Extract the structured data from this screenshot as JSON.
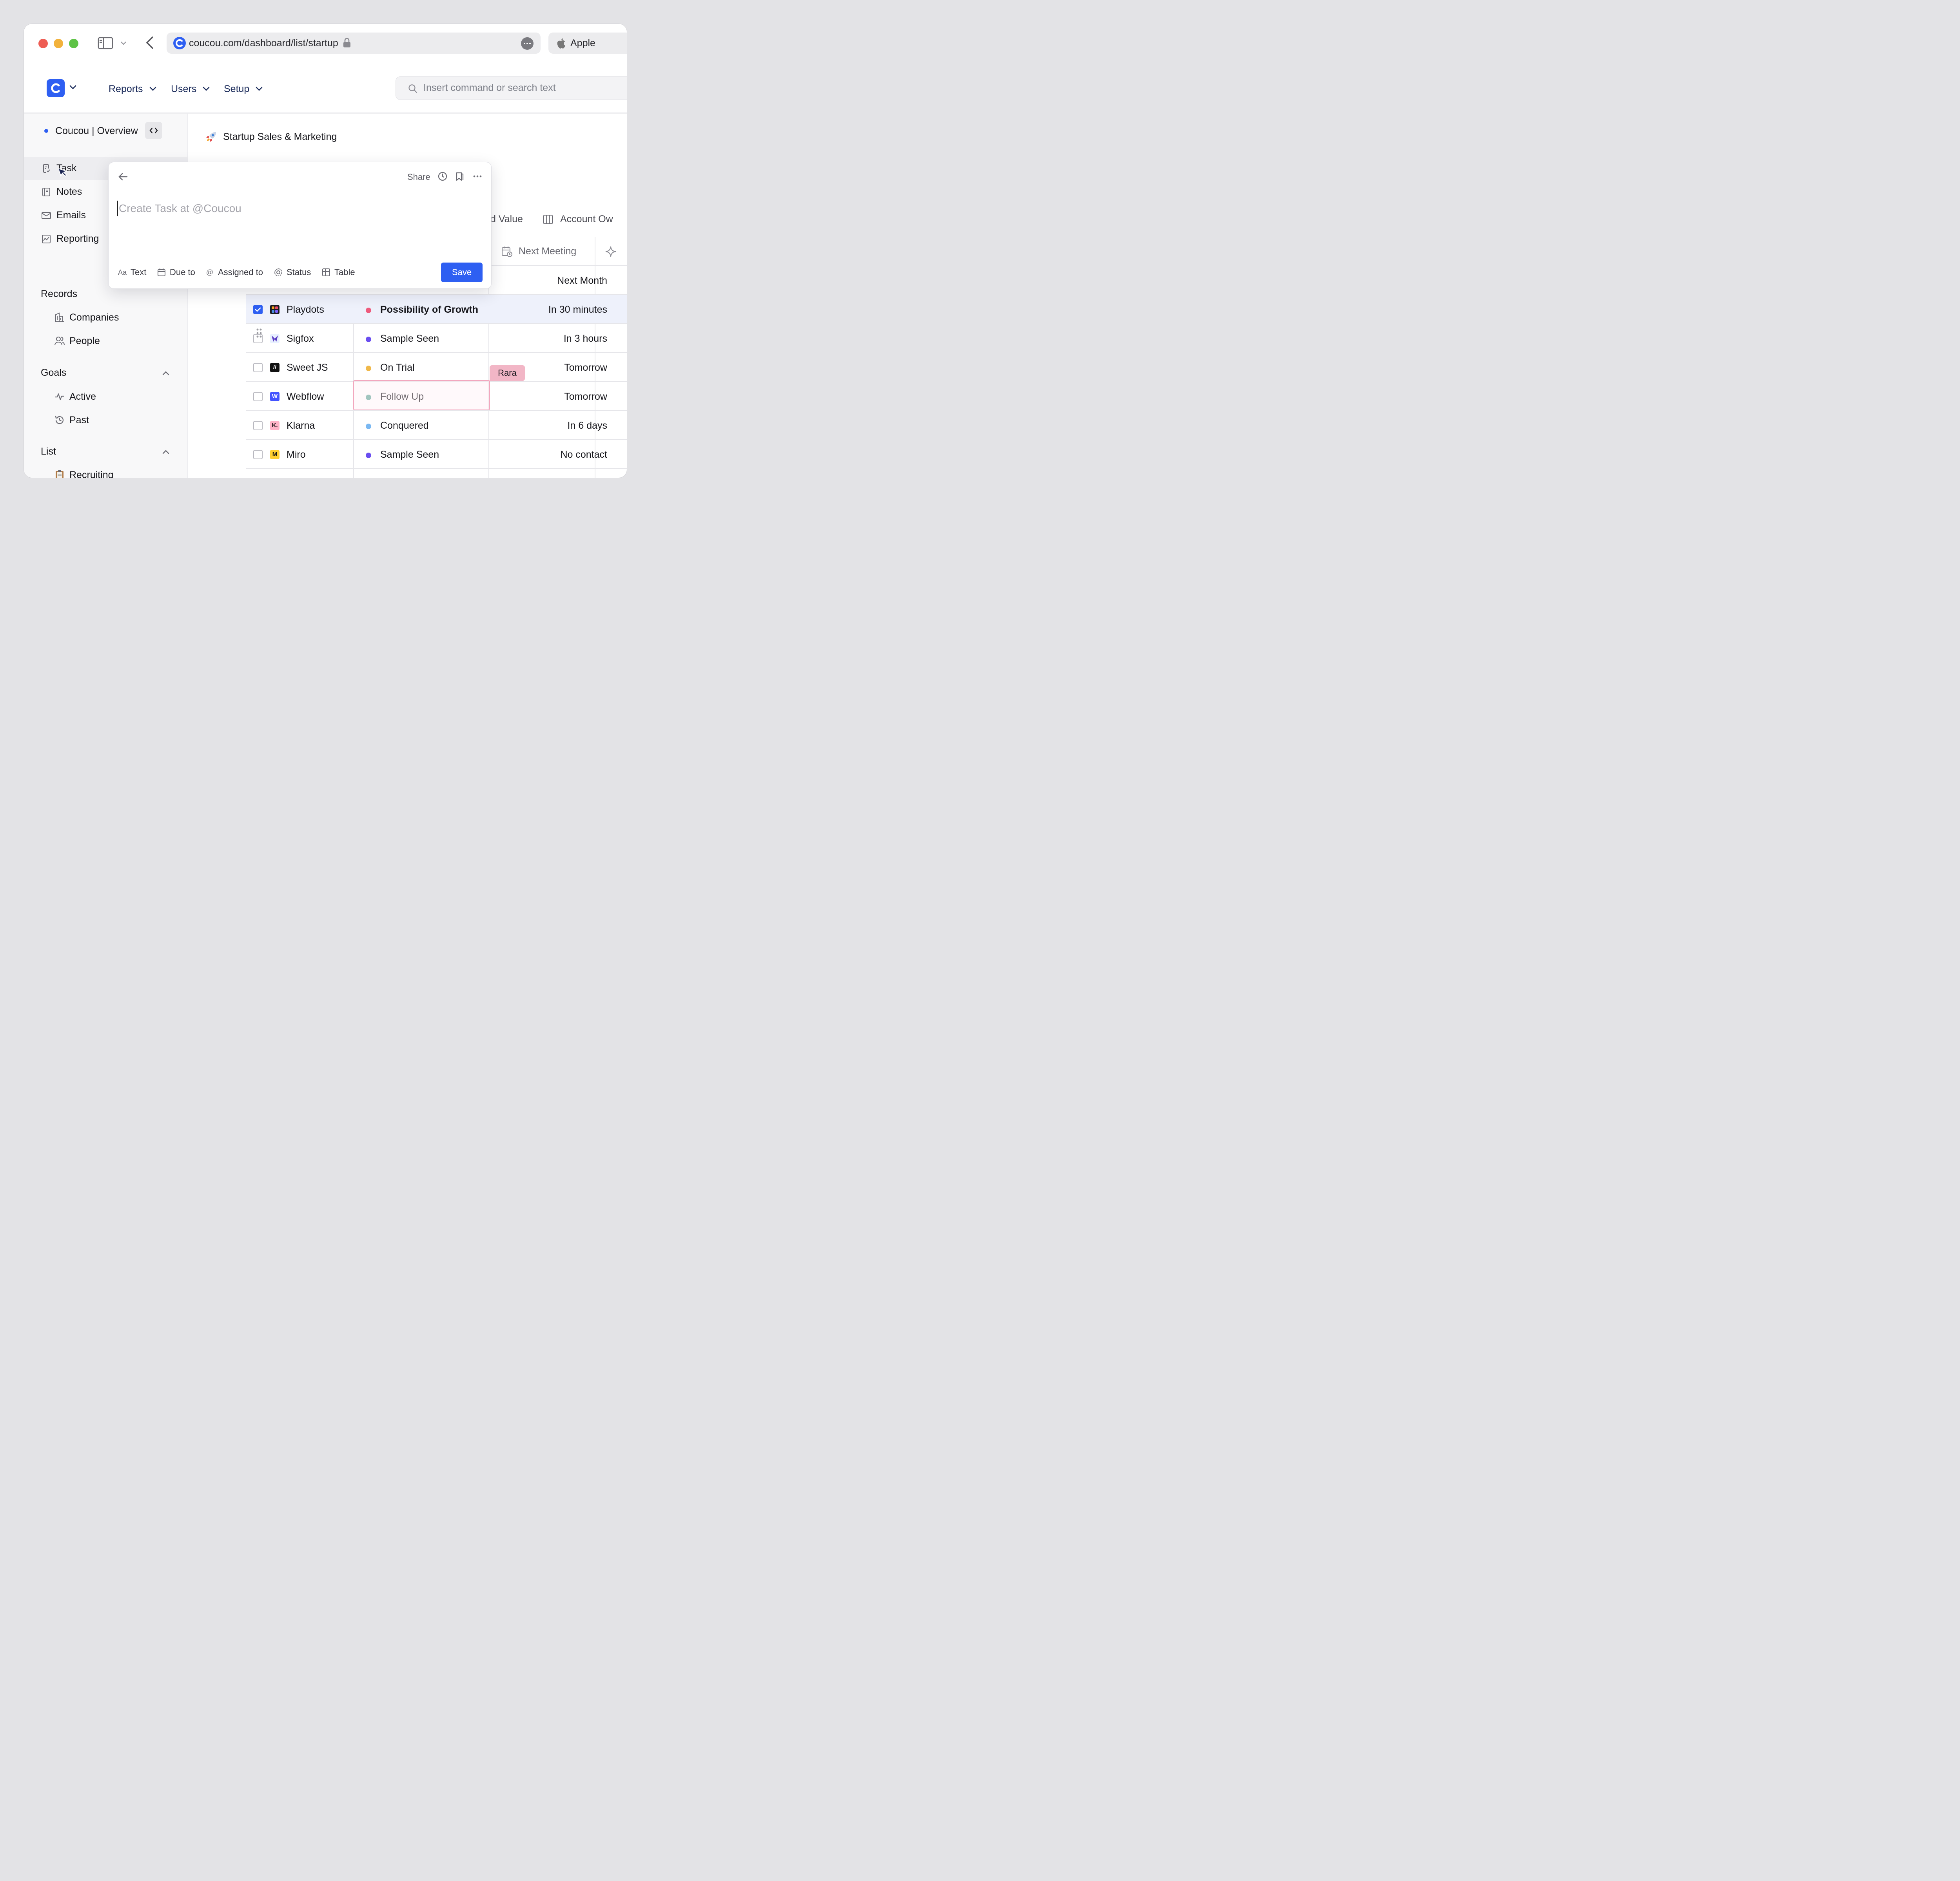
{
  "browser": {
    "url": "coucou.com/dashboard/list/startup",
    "tab_label": "Apple"
  },
  "nav": {
    "items": [
      {
        "label": "Reports"
      },
      {
        "label": "Users"
      },
      {
        "label": "Setup"
      }
    ],
    "search_placeholder": "Insert command or search text"
  },
  "sidebar": {
    "workspace": "Coucou | Overview",
    "items": [
      {
        "label": "Task",
        "icon": "task-icon"
      },
      {
        "label": "Notes",
        "icon": "notes-icon"
      },
      {
        "label": "Emails",
        "icon": "mail-icon"
      },
      {
        "label": "Reporting",
        "icon": "chart-icon"
      }
    ],
    "records": {
      "title": "Records",
      "items": [
        {
          "label": "Companies",
          "icon": "building-icon"
        },
        {
          "label": "People",
          "icon": "people-icon"
        }
      ]
    },
    "goals": {
      "title": "Goals",
      "items": [
        {
          "label": "Active",
          "icon": "pulse-icon"
        },
        {
          "label": "Past",
          "icon": "history-icon"
        }
      ]
    },
    "list": {
      "title": "List",
      "items": [
        {
          "label": "Recruiting",
          "icon": "clipboard-icon"
        }
      ]
    }
  },
  "page": {
    "title": "Startup Sales & Marketing",
    "column_tags": [
      "d Value",
      "Account Ow"
    ],
    "next_meeting_header": "Next Meeting"
  },
  "table": {
    "rows": [
      {
        "company": "",
        "stage": "",
        "meeting": "Next Month",
        "checked": false,
        "spark_color": "#1fc29a"
      },
      {
        "company": "Playdots",
        "stage": "Possibility of Growth",
        "meeting": "In 30 minutes",
        "checked": true,
        "dot": "#ee5a7c",
        "spark_color": "#f29a2e"
      },
      {
        "company": "Sigfox",
        "stage": "Sample Seen",
        "meeting": "In 3 hours",
        "checked": false,
        "dot": "#6a4ef0",
        "spark_color": "#f5d21e"
      },
      {
        "company": "Sweet JS",
        "stage": "On Trial",
        "meeting": "Tomorrow",
        "checked": false,
        "dot": "#f0b84a",
        "spark_color": "#f0455a"
      },
      {
        "company": "Webflow",
        "stage": "Follow Up",
        "meeting": "Tomorrow",
        "checked": false,
        "dot": "#63a89c",
        "spark_color": "#1fc29a"
      },
      {
        "company": "Klarna",
        "stage": "Conquered",
        "meeting": "In 6 days",
        "checked": false,
        "dot": "#7ab8f2",
        "spark_color": "#f29a2e"
      },
      {
        "company": "Miro",
        "stage": "Sample Seen",
        "meeting": "No contact",
        "checked": false,
        "dot": "#6a4ef0",
        "spark_color": "#f5d21e"
      }
    ],
    "collaborator_tag": "Rara"
  },
  "modal": {
    "share_label": "Share",
    "input_placeholder": "Create Task at @Coucou",
    "tools": [
      {
        "label": "Text",
        "icon": "text-icon"
      },
      {
        "label": "Due to",
        "icon": "calendar-icon"
      },
      {
        "label": "Assigned to",
        "icon": "at-icon"
      },
      {
        "label": "Status",
        "icon": "status-icon"
      },
      {
        "label": "Table",
        "icon": "table-icon"
      }
    ],
    "save_label": "Save"
  },
  "colors": {
    "accent": "#2e5ff2",
    "nav_text": "#1d2d5c"
  }
}
